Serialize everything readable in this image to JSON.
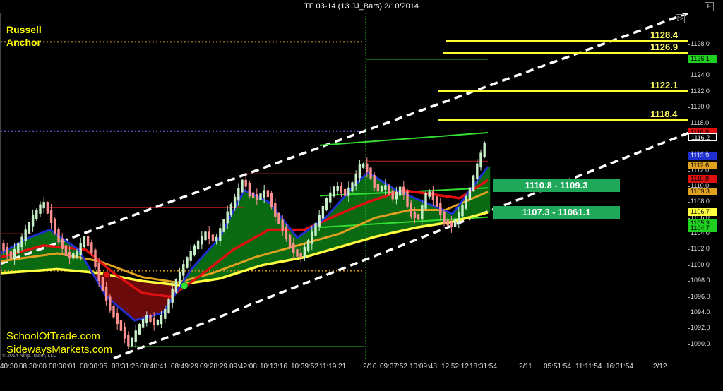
{
  "window": {
    "title": "TF 03-14 (13 JJ_Bars)  2/10/2014"
  },
  "overlay": {
    "anchor_line1": "Russell",
    "anchor_line2": "Anchor",
    "site1": "SchoolOfTrade.com",
    "site2": "SidewaysMarkets.com",
    "copyright": "© 2014 NinjaTrader, LLC"
  },
  "buttons": {
    "collapse": "▷",
    "format": "F"
  },
  "colors": {
    "background": "#000000",
    "up_bar": "#c8f0c8",
    "down_bar": "#ff9090",
    "ema_fast": "#1f2fd0",
    "ema_mid": "#e01010",
    "ema_slow": "#e0a020",
    "ema_long": "#ffff40",
    "cloud_bull": "#0b6b12",
    "cloud_bear": "#6b0b0b",
    "channel": "#ffffff",
    "levels": "#ffff33",
    "zone": "#1fa85a"
  },
  "levels": [
    {
      "label": "1128.4",
      "value": 1128.4
    },
    {
      "label": "1126.9",
      "value": 1126.9
    },
    {
      "label": "1122.1",
      "value": 1122.1
    },
    {
      "label": "1118.4",
      "value": 1118.4
    }
  ],
  "zones": [
    {
      "label": "1110.8 - 1109.3",
      "high": 1110.8,
      "low": 1109.3
    },
    {
      "label": "1107.3 - 11061.1",
      "high": 1107.3,
      "low": 1106.1
    }
  ],
  "y_markers": [
    {
      "label": "1126.1",
      "value": 1126.1,
      "bg": "#1fd020",
      "fg": "#000000"
    },
    {
      "label": "1116.8",
      "value": 1116.8,
      "bg": "#e01010",
      "fg": "#000000"
    },
    {
      "label": "1116.2",
      "value": 1116.2,
      "bg": "#000000",
      "fg": "#ffffff"
    },
    {
      "label": "1113.9",
      "value": 1113.9,
      "bg": "#1f2fd0",
      "fg": "#ffffff"
    },
    {
      "label": "1112.6",
      "value": 1112.6,
      "bg": "#e0a020",
      "fg": "#000000"
    },
    {
      "label": "1110.9",
      "value": 1110.9,
      "bg": "#e01010",
      "fg": "#000000"
    },
    {
      "label": "1109.3",
      "value": 1109.3,
      "bg": "#e0a020",
      "fg": "#000000"
    },
    {
      "label": "1106.7",
      "value": 1106.7,
      "bg": "#ffff40",
      "fg": "#000000"
    },
    {
      "label": "1105.3",
      "value": 1105.3,
      "bg": "#1fd020",
      "fg": "#000000"
    },
    {
      "label": "1104.7",
      "value": 1104.7,
      "bg": "#1fd020",
      "fg": "#000000"
    }
  ],
  "chart_data": {
    "type": "candlestick",
    "title": "TF 03-14 (13 JJ_Bars)  2/10/2014",
    "ylim": [
      1088,
      1132
    ],
    "y_ticks": [
      "1090.0",
      "1092.0",
      "1094.0",
      "1096.0",
      "1098.0",
      "1100.0",
      "1102.0",
      "1104.0",
      "1106.0",
      "1108.0",
      "1110.0",
      "1112.0",
      "1114.0",
      "1116.0",
      "1118.0",
      "1120.0",
      "1122.0",
      "1124.0",
      "1126.0",
      "1128.0"
    ],
    "x_ticks": [
      "40:30",
      "08:30:00",
      "08:30:01",
      "08:30:05",
      "08:31:25",
      "08:40:41",
      "08:49:29",
      "09:28:29",
      "09:42:08",
      "10:13:16",
      "10:39:52",
      "11:19:21",
      "2/10",
      "09:37:52",
      "10:09:48",
      "12:52:12",
      "18:31:54",
      "2/11",
      "05:51:54",
      "11:11:54",
      "16:31:54",
      "2/12"
    ],
    "session_break_label": "2/10",
    "price_path": [
      [
        0,
        1102.5
      ],
      [
        14,
        1101.0
      ],
      [
        28,
        1103.0
      ],
      [
        45,
        1106.0
      ],
      [
        60,
        1108.0
      ],
      [
        68,
        1106.5
      ],
      [
        80,
        1103.5
      ],
      [
        95,
        1101.0
      ],
      [
        108,
        1101.5
      ],
      [
        118,
        1103.5
      ],
      [
        128,
        1102.0
      ],
      [
        140,
        1098.0
      ],
      [
        155,
        1094.5
      ],
      [
        170,
        1092.0
      ],
      [
        182,
        1089.8
      ],
      [
        194,
        1092.0
      ],
      [
        206,
        1093.5
      ],
      [
        220,
        1092.5
      ],
      [
        232,
        1094.0
      ],
      [
        246,
        1097.5
      ],
      [
        262,
        1100.5
      ],
      [
        276,
        1102.5
      ],
      [
        290,
        1104.0
      ],
      [
        304,
        1103.0
      ],
      [
        318,
        1106.0
      ],
      [
        332,
        1108.5
      ],
      [
        344,
        1111.0
      ],
      [
        352,
        1109.0
      ],
      [
        364,
        1108.5
      ],
      [
        376,
        1109.5
      ],
      [
        388,
        1106.5
      ],
      [
        400,
        1104.5
      ],
      [
        412,
        1102.0
      ],
      [
        424,
        1101.0
      ],
      [
        436,
        1103.0
      ],
      [
        448,
        1105.5
      ],
      [
        460,
        1108.0
      ],
      [
        474,
        1110.0
      ],
      [
        488,
        1109.0
      ],
      [
        500,
        1110.5
      ],
      [
        510,
        1113.0
      ],
      [
        520,
        1112.0
      ],
      [
        532,
        1109.5
      ],
      [
        544,
        1110.0
      ],
      [
        556,
        1108.5
      ],
      [
        568,
        1110.0
      ],
      [
        580,
        1106.5
      ],
      [
        592,
        1106.0
      ],
      [
        604,
        1109.5
      ],
      [
        616,
        1108.0
      ],
      [
        628,
        1105.5
      ],
      [
        640,
        1105.0
      ],
      [
        652,
        1107.0
      ],
      [
        664,
        1109.5
      ],
      [
        676,
        1113.0
      ],
      [
        690,
        1116.5
      ]
    ],
    "ema_fast": [
      [
        0,
        1101.5
      ],
      [
        40,
        1103.5
      ],
      [
        70,
        1104.5
      ],
      [
        110,
        1102.0
      ],
      [
        150,
        1096.0
      ],
      [
        190,
        1093.0
      ],
      [
        230,
        1094.0
      ],
      [
        270,
        1099.5
      ],
      [
        310,
        1103.5
      ],
      [
        345,
        1109.5
      ],
      [
        380,
        1108.0
      ],
      [
        420,
        1103.5
      ],
      [
        460,
        1106.0
      ],
      [
        500,
        1110.0
      ],
      [
        520,
        1111.8
      ],
      [
        560,
        1109.5
      ],
      [
        600,
        1108.0
      ],
      [
        640,
        1106.5
      ],
      [
        690,
        1112.5
      ]
    ],
    "ema_mid": [
      [
        0,
        1101.0
      ],
      [
        60,
        1102.5
      ],
      [
        120,
        1102.0
      ],
      [
        160,
        1099.0
      ],
      [
        200,
        1096.5
      ],
      [
        240,
        1096.0
      ],
      [
        280,
        1098.5
      ],
      [
        330,
        1102.0
      ],
      [
        380,
        1104.5
      ],
      [
        430,
        1104.5
      ],
      [
        480,
        1106.5
      ],
      [
        520,
        1108.0
      ],
      [
        570,
        1109.5
      ],
      [
        610,
        1109.0
      ],
      [
        650,
        1108.5
      ],
      [
        690,
        1110.8
      ]
    ],
    "ema_slow": [
      [
        0,
        1100.5
      ],
      [
        80,
        1101.5
      ],
      [
        140,
        1100.5
      ],
      [
        200,
        1098.5
      ],
      [
        250,
        1097.8
      ],
      [
        300,
        1099.0
      ],
      [
        360,
        1101.0
      ],
      [
        420,
        1102.5
      ],
      [
        480,
        1104.0
      ],
      [
        530,
        1106.0
      ],
      [
        580,
        1107.0
      ],
      [
        630,
        1107.0
      ],
      [
        690,
        1109.3
      ]
    ],
    "ema_long": [
      [
        0,
        1099.0
      ],
      [
        80,
        1099.5
      ],
      [
        140,
        1099.0
      ],
      [
        200,
        1098.0
      ],
      [
        250,
        1097.5
      ],
      [
        310,
        1098.3
      ],
      [
        370,
        1100.0
      ],
      [
        430,
        1101.0
      ],
      [
        480,
        1102.3
      ],
      [
        530,
        1103.6
      ],
      [
        590,
        1104.8
      ],
      [
        640,
        1105.5
      ],
      [
        690,
        1106.7
      ]
    ],
    "channel_upper": [
      [
        0,
        1100.2
      ],
      [
        975,
        1132.0
      ]
    ],
    "channel_lower": [
      [
        160,
        1088.2
      ],
      [
        975,
        1116.8
      ]
    ],
    "reference_lines": [
      {
        "kind": "hline",
        "value": 1104.0,
        "x_range": [
          0,
          45
        ],
        "color": "#c02020"
      },
      {
        "kind": "hline",
        "value": 1107.3,
        "x_range": [
          65,
          345
        ],
        "color": "#c02020"
      },
      {
        "kind": "hline",
        "value": 1111.6,
        "x_range": [
          345,
          515
        ],
        "color": "#c02020"
      },
      {
        "kind": "hline",
        "value": 1113.2,
        "x_range": [
          518,
          690
        ],
        "color": "#c02020"
      },
      {
        "kind": "hline",
        "value": 1099.3,
        "x_range": [
          0,
          515
        ],
        "color": "#c89020"
      },
      {
        "kind": "hline",
        "value": 1128.3,
        "x_range": [
          0,
          515
        ],
        "color": "#c89020"
      },
      {
        "kind": "hline",
        "value": 1089.7,
        "x_range": [
          180,
          515
        ],
        "color": "#2ec22e"
      },
      {
        "kind": "hline",
        "value": 1126.1,
        "x_range": [
          518,
          690
        ],
        "color": "#2ec22e"
      },
      {
        "kind": "hline",
        "value": 1117.0,
        "x_range": [
          0,
          515
        ],
        "color": "#7070ff"
      }
    ],
    "green_trendlines": [
      [
        [
          452,
          1115.2
        ],
        [
          690,
          1116.8
        ]
      ],
      [
        [
          452,
          1104.8
        ],
        [
          690,
          1106.1
        ]
      ],
      [
        [
          452,
          1108.8
        ],
        [
          690,
          1109.8
        ]
      ]
    ],
    "signals": [
      {
        "x": 150,
        "value": 1098.8,
        "color": "#e01010"
      },
      {
        "x": 260,
        "value": 1097.4,
        "color": "#30e030"
      }
    ]
  }
}
